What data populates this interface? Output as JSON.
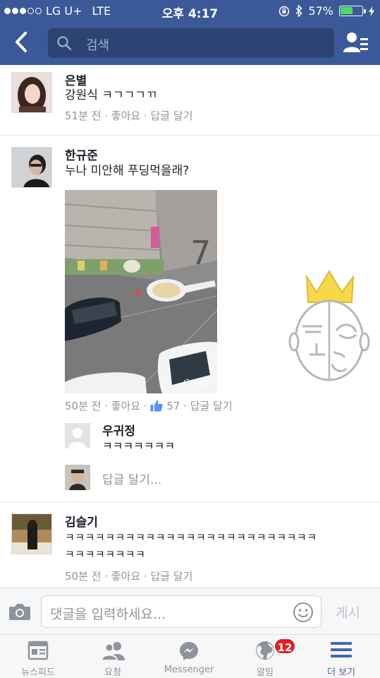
{
  "status_bar": {
    "carrier": "LG U+",
    "network": "LTE",
    "time": "오후 4:17",
    "battery_percent": "57%",
    "battery_level": 0.57
  },
  "header": {
    "search_placeholder": "검색",
    "icons": {
      "back": "chevron-left-icon",
      "search": "search-icon",
      "friends": "friend-list-icon"
    }
  },
  "comments": [
    {
      "name": "은별",
      "text": "강원식 ㅋㄱㄱㄱㄲ",
      "meta": "51분 전 · 좋아요 · 답글 달기"
    },
    {
      "name": "한규준",
      "text": "누나 미안해 푸딩먹을래?",
      "photo_watermark": "Candy",
      "meta_time": "50분 전 · 좋아요 ·",
      "like_count": "57",
      "meta_reply": "· 답글 달기",
      "reply": {
        "name": "우귀정",
        "text": "ㅋㅋㅋㅋㅋㅋㅋ"
      },
      "reply_prompt": "답글 달기..."
    },
    {
      "name": "김슬기",
      "text_line1": "ㅋㅋㅋㅋㅋㅋㅋㅋㅋㅋㅋㅋㅋㅋㅋㅋㅋㅋㅋㅋㅋㅋㅋㅋㅋ",
      "text_line2": "ㅋㅋㅋㅋㅋㅋㅋㅋ",
      "meta": "50분 전 · 좋아요 · 답글 달기"
    }
  ],
  "composer": {
    "placeholder": "댓글을 입력하세요...",
    "post_label": "게시",
    "icons": {
      "camera": "camera-icon",
      "emoji": "smiley-icon"
    }
  },
  "tabs": [
    {
      "label": "뉴스피드",
      "icon": "news-feed-icon"
    },
    {
      "label": "요청",
      "icon": "friend-requests-icon"
    },
    {
      "label": "Messenger",
      "icon": "messenger-icon"
    },
    {
      "label": "알림",
      "icon": "globe-icon",
      "badge": "12"
    },
    {
      "label": "더 보기",
      "icon": "menu-icon",
      "active": true
    }
  ],
  "colors": {
    "brand": "#3b5998",
    "active_tab": "#4267b2",
    "badge": "#e41c23",
    "meta_text": "#90949c"
  }
}
